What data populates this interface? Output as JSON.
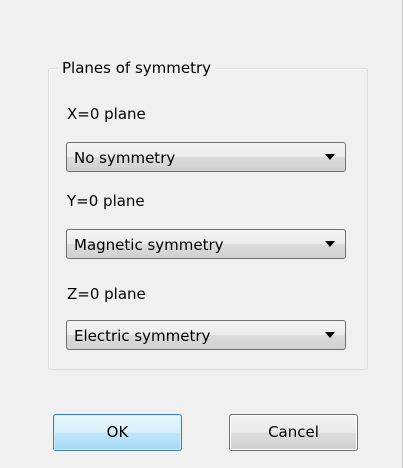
{
  "group": {
    "title": "Planes of symmetry"
  },
  "planes": [
    {
      "label": "X=0 plane",
      "value": "No symmetry"
    },
    {
      "label": "Y=0 plane",
      "value": "Magnetic symmetry"
    },
    {
      "label": "Z=0 plane",
      "value": "Electric symmetry"
    }
  ],
  "buttons": {
    "ok_label": "OK",
    "cancel_label": "Cancel"
  },
  "icons": {
    "dropdown": "chevron-down-icon"
  }
}
